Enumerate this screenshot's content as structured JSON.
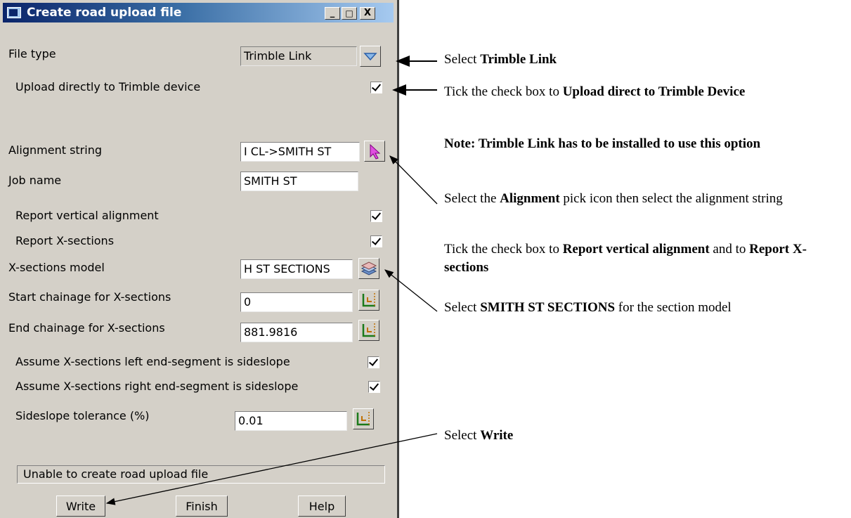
{
  "window": {
    "title": "Create road upload file",
    "controls": {
      "minimize": "_",
      "maximize": "□",
      "close": "X"
    }
  },
  "form": {
    "file_type": {
      "label": "File type",
      "value": "Trimble Link"
    },
    "upload_direct": {
      "label": "Upload directly to Trimble device",
      "checked": true
    },
    "alignment_string": {
      "label": "Alignment string",
      "value": "I CL->SMITH ST"
    },
    "job_name": {
      "label": "Job name",
      "value": "SMITH ST"
    },
    "report_vertical": {
      "label": "Report vertical alignment",
      "checked": true
    },
    "report_xsections": {
      "label": "Report X-sections",
      "checked": true
    },
    "xsections_model": {
      "label": "X-sections model",
      "value": "H ST SECTIONS"
    },
    "start_chainage": {
      "label": "Start chainage for X-sections",
      "value": "0"
    },
    "end_chainage": {
      "label": "End chainage for X-sections",
      "value": "881.9816"
    },
    "left_sideslope": {
      "label": "Assume X-sections left end-segment is sideslope",
      "checked": true
    },
    "right_sideslope": {
      "label": "Assume X-sections right end-segment is sideslope",
      "checked": true
    },
    "sideslope_tolerance": {
      "label": "Sideslope tolerance (%)",
      "value": "0.01"
    }
  },
  "status_message": "Unable to create road upload file",
  "buttons": {
    "write": "Write",
    "finish": "Finish",
    "help": "Help"
  },
  "annotations": {
    "file_type": {
      "pre": "Select ",
      "bold": "Trimble Link"
    },
    "upload": {
      "pre": "Tick the check box to ",
      "bold": "Upload direct to Trimble Device"
    },
    "note": "Note: Trimble Link has to be installed to use this option",
    "alignment": {
      "pre": "Select the ",
      "bold": "Alignment",
      "post": " pick icon then select the alignment string"
    },
    "report": {
      "pre": "Tick the check box to ",
      "bold1": "Report vertical alignment",
      "mid": " and to ",
      "bold2": "Report X-sections"
    },
    "section_model": {
      "pre": "Select ",
      "bold": "SMITH ST SECTIONS",
      "post": " for the section model"
    },
    "write": {
      "pre": "Select ",
      "bold": "Write"
    }
  },
  "colors": {
    "title_bar_start": "#0a246a",
    "title_bar_end": "#a6caf0",
    "dialog_bg": "#d4d0c8",
    "field_bg": "#ffffff"
  }
}
